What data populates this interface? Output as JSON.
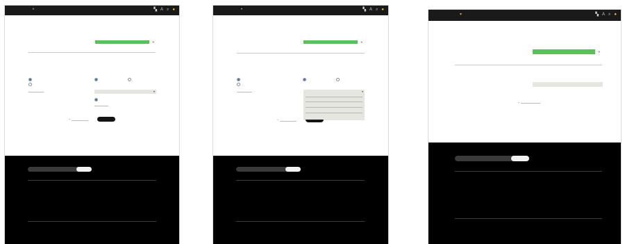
{
  "app": {
    "title": ""
  },
  "icons": [
    {
      "name": "cart-icon",
      "glyph": "▚"
    },
    {
      "name": "user-icon",
      "glyph": "A"
    },
    {
      "name": "search-icon",
      "glyph": "⌕"
    },
    {
      "name": "sun-icon",
      "glyph": "●"
    }
  ],
  "dropdown": {
    "chevron": "▾"
  },
  "colors": {
    "accent_green": "#5cbf5c",
    "header_bg": "#1a1a1a",
    "footer_bg": "#000000",
    "select_bg": "#e6e6e0",
    "radio_selected": "#5b7290",
    "button_dark": "#141414"
  },
  "screens": [
    {
      "id": "screen-1",
      "state": "default",
      "dropdown_open": false
    },
    {
      "id": "screen-2",
      "state": "dropdown-open",
      "dropdown_open": true
    },
    {
      "id": "screen-3",
      "state": "scrolled",
      "dropdown_open": false
    }
  ]
}
